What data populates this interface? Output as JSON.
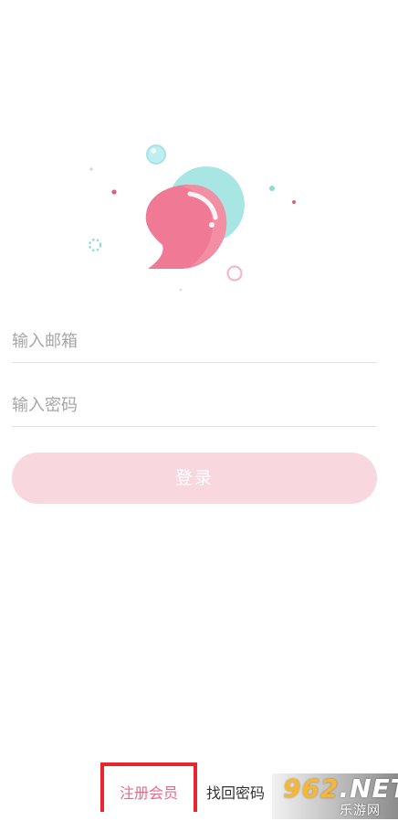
{
  "login_form": {
    "email_placeholder": "输入邮箱",
    "password_placeholder": "输入密码",
    "login_label": "登录"
  },
  "bottom_links": {
    "register_label": "注册会员",
    "forgot_label": "找回密码"
  },
  "watermark": {
    "brand_prefix": "962",
    "brand_suffix": ".NET",
    "site_name": "乐游网"
  },
  "colors": {
    "primary_pink": "#f07a96",
    "login_button_bg": "#f9d7de",
    "teal_bubble": "#a8e6e4",
    "highlight_border": "#e8262f"
  },
  "logo": {
    "icon": "chat-bubble-icon"
  }
}
